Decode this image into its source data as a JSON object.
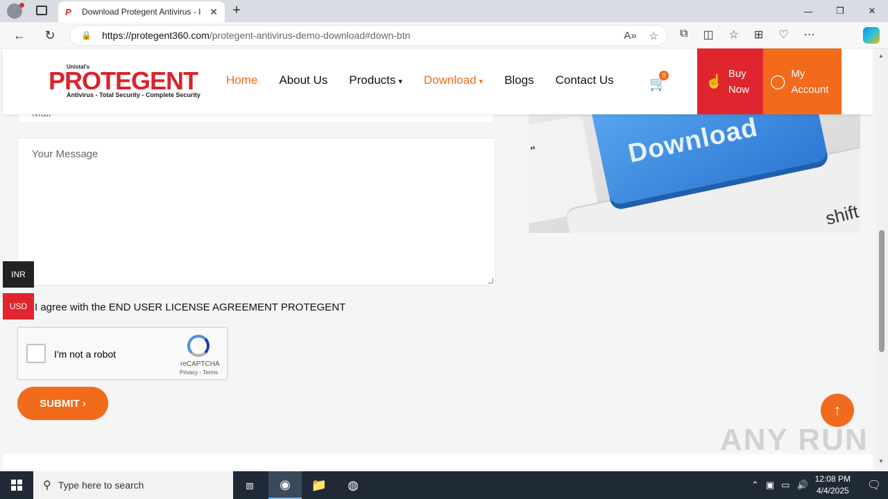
{
  "browser": {
    "tab_title": "Download Protegent Antivirus - I",
    "tab_favicon": "P",
    "url_host": "https://protegent360.com",
    "url_path": "/protegent-antivirus-demo-download#down-btn"
  },
  "site": {
    "logo": {
      "small": "Unistal's",
      "big": "PROTEGENT",
      "tagline": "Antivirus - Total Security - Complete Security"
    },
    "menu": [
      {
        "label": "Home",
        "active": true
      },
      {
        "label": "About Us"
      },
      {
        "label": "Products",
        "caret": "▾"
      },
      {
        "label": "Download",
        "caret": "▾",
        "active": true
      },
      {
        "label": "Blogs"
      },
      {
        "label": "Contact Us"
      }
    ],
    "cart_count": "0",
    "buy_now": [
      "Buy",
      "Now"
    ],
    "my_account": [
      "My",
      "Account"
    ],
    "accent_color": "#f26a1b",
    "brand_red": "#e1252e"
  },
  "form": {
    "prev_field_text": "Mail",
    "message_placeholder": "Your Message",
    "agree_text": "I agree with the END USER LICENSE AGREEMENT PROTEGENT",
    "captcha_label": "I'm not a robot",
    "captcha_brand": "reCAPTCHA",
    "captcha_links": "Privacy - Terms",
    "submit_label": "SUBMIT ›"
  },
  "currency": {
    "inr": "INR",
    "usd": "USD"
  },
  "image": {
    "key_text": "Download",
    "shift_text": "shift",
    "left_key_text": "\""
  },
  "watermark": "ANY RUN",
  "taskbar": {
    "search_placeholder": "Type here to search",
    "time": "12:08 PM",
    "date": "4/4/2025"
  }
}
